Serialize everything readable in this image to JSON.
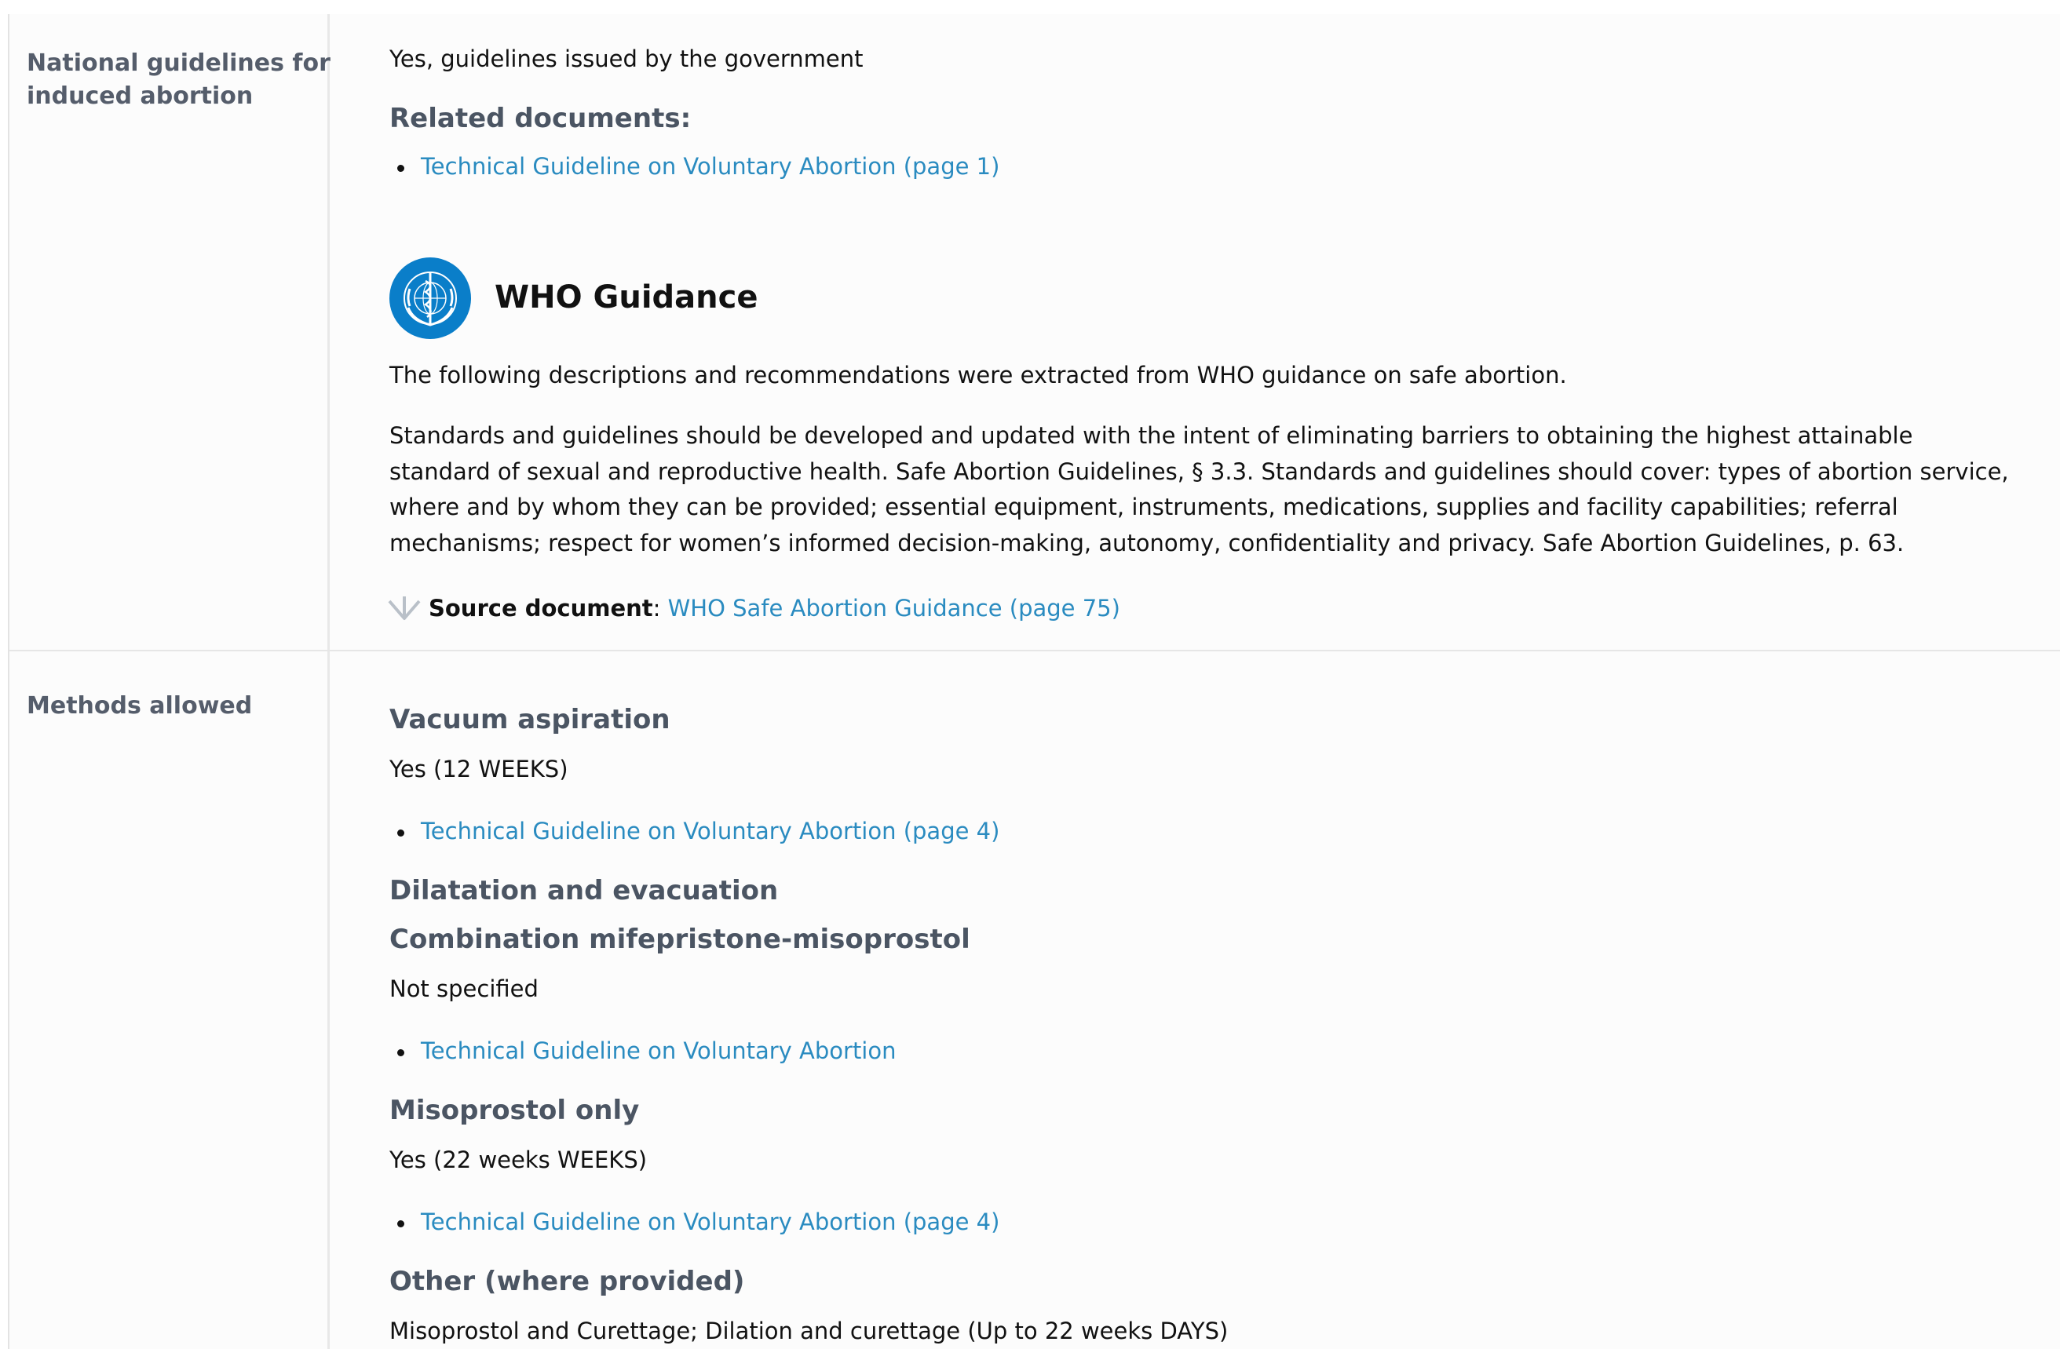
{
  "rows": {
    "guidelines": {
      "label": "National guidelines for induced abortion",
      "answer": "Yes, guidelines issued by the government",
      "related_heading": "Related documents:",
      "related_links": [
        "Technical Guideline on Voluntary Abortion (page 1)"
      ],
      "who": {
        "title": "WHO Guidance",
        "intro": "The following descriptions and recommendations were extracted from WHO guidance on safe abortion.",
        "body": "Standards and guidelines should be developed and updated with the intent of eliminating barriers to obtaining the highest attainable standard of sexual and reproductive health. Safe Abortion Guidelines, § 3.3. Standards and guidelines should cover: types of abortion service, where and by whom they can be provided; essential equipment, instruments, medications, supplies and facility capabilities; referral mechanisms; respect for women’s informed decision-making, autonomy, confidentiality and privacy. Safe Abortion Guidelines, p. 63.",
        "source_label": "Source document",
        "source_sep": ":",
        "source_link": "WHO Safe Abortion Guidance (page 75)"
      }
    },
    "methods": {
      "label": "Methods allowed",
      "items": [
        {
          "heading": "Vacuum aspiration",
          "value": "Yes (12 WEEKS)",
          "link": "Technical Guideline on Voluntary Abortion (page 4)"
        },
        {
          "heading": "Dilatation and evacuation"
        },
        {
          "heading": "Combination mifepristone-misoprostol",
          "value": "Not specified",
          "link": "Technical Guideline on Voluntary Abortion"
        },
        {
          "heading": "Misoprostol only",
          "value": "Yes (22 weeks WEEKS)",
          "link": "Technical Guideline on Voluntary Abortion (page 4)"
        },
        {
          "heading": "Other (where provided)",
          "value": "Misoprostol and Curettage; Dilation and curettage (Up to 22 weeks DAYS)"
        }
      ]
    }
  }
}
